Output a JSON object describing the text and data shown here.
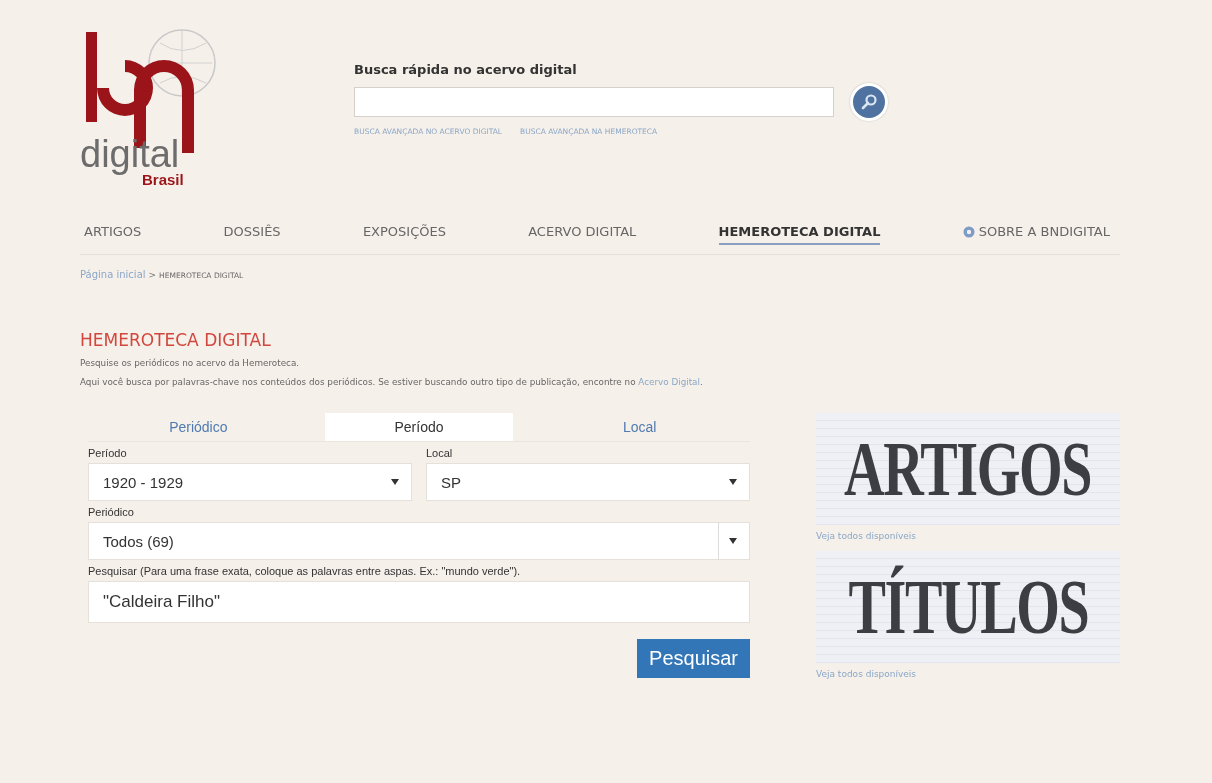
{
  "logo": {
    "wordmark": "digital",
    "sub": "Brasil"
  },
  "quick_search": {
    "label": "Busca rápida no acervo digital",
    "links": [
      "BUSCA AVANÇADA NO ACERVO DIGITAL",
      "BUSCA AVANÇADA NA HEMEROTECA"
    ]
  },
  "nav": [
    {
      "label": "ARTIGOS",
      "selected": false,
      "kind": "plain"
    },
    {
      "label": "DOSSIÊS",
      "selected": false,
      "kind": "plain"
    },
    {
      "label": "EXPOSIÇÕES",
      "selected": false,
      "kind": "plain"
    },
    {
      "label": "ACERVO DIGITAL",
      "selected": false,
      "kind": "plain"
    },
    {
      "label": "HEMEROTECA DIGITAL",
      "selected": true,
      "kind": "plain"
    },
    {
      "label": "SOBRE A BNDIGITAL",
      "selected": false,
      "kind": "info"
    }
  ],
  "breadcrumb": {
    "home": "Página inicial",
    "separator": ">",
    "current": "HEMEROTECA DIGITAL"
  },
  "section": {
    "title": "HEMEROTECA DIGITAL",
    "intro": "Pesquise os periódicos no acervo da Hemeroteca.",
    "note": "Aqui você busca por palavras-chave nos conteúdos dos periódicos. Se estiver buscando outro tipo de publicação, encontre no",
    "note_link": "Acervo Digital",
    "note_end": "."
  },
  "tabs": [
    {
      "label": "Periódico",
      "selected": false
    },
    {
      "label": "Período",
      "selected": true
    },
    {
      "label": "Local",
      "selected": false
    }
  ],
  "form": {
    "periodo": {
      "label": "Período",
      "value": "1920 - 1929"
    },
    "local": {
      "label": "Local",
      "value": "SP"
    },
    "periodico": {
      "label": "Periódico",
      "value": "Todos (69)"
    },
    "query": {
      "label": "Pesquisar (Para uma frase exata, coloque as palavras entre aspas. Ex.: \"mundo verde\").",
      "value": "\"Caldeira Filho\""
    },
    "submit": "Pesquisar"
  },
  "promos": [
    {
      "title": "ARTIGOS",
      "link": "Veja todos disponíveis"
    },
    {
      "title": "TÍTULOS",
      "link": "Veja todos disponíveis"
    }
  ]
}
